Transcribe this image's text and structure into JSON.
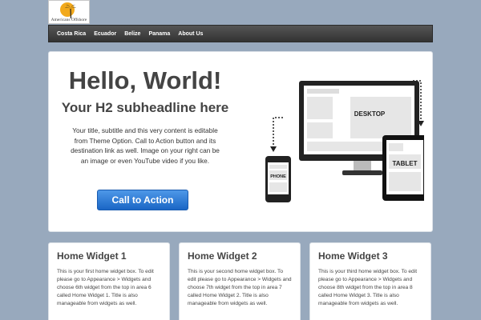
{
  "logo": {
    "text": "Americans Offshore"
  },
  "nav": {
    "items": [
      "Costa Rica",
      "Ecuador",
      "Belize",
      "Panama",
      "About Us"
    ]
  },
  "hero": {
    "title": "Hello, World!",
    "subtitle": "Your H2 subheadline here",
    "body": "Your title, subtitle and this very content is editable from Theme Option. Call to Action button and its destination link as well. Image on your right can be an image or even YouTube video if you like.",
    "cta_label": "Call to Action",
    "devices": {
      "desktop": "DESKTOP",
      "tablet": "TABLET",
      "phone": "PHONE"
    }
  },
  "widgets": [
    {
      "title": "Home Widget 1",
      "body": "This is your first home widget box. To edit please go to Appearance > Widgets and choose 6th widget from the top in area 6 called Home Widget 1. Title is also manageable from widgets as well."
    },
    {
      "title": "Home Widget 2",
      "body": "This is your second home widget box. To edit please go to Appearance > Widgets and choose 7th widget from the top in area 7 called Home Widget 2. Title is also manageable from widgets as well."
    },
    {
      "title": "Home Widget 3",
      "body": "This is your third home widget box. To edit please go to Appearance > Widgets and choose 8th widget from the top in area 8 called Home Widget 3. Title is also manageable from widgets as well."
    }
  ],
  "colors": {
    "page_bg": "#98a9bd",
    "cta": "#2a78d8",
    "nav": "#444444"
  }
}
